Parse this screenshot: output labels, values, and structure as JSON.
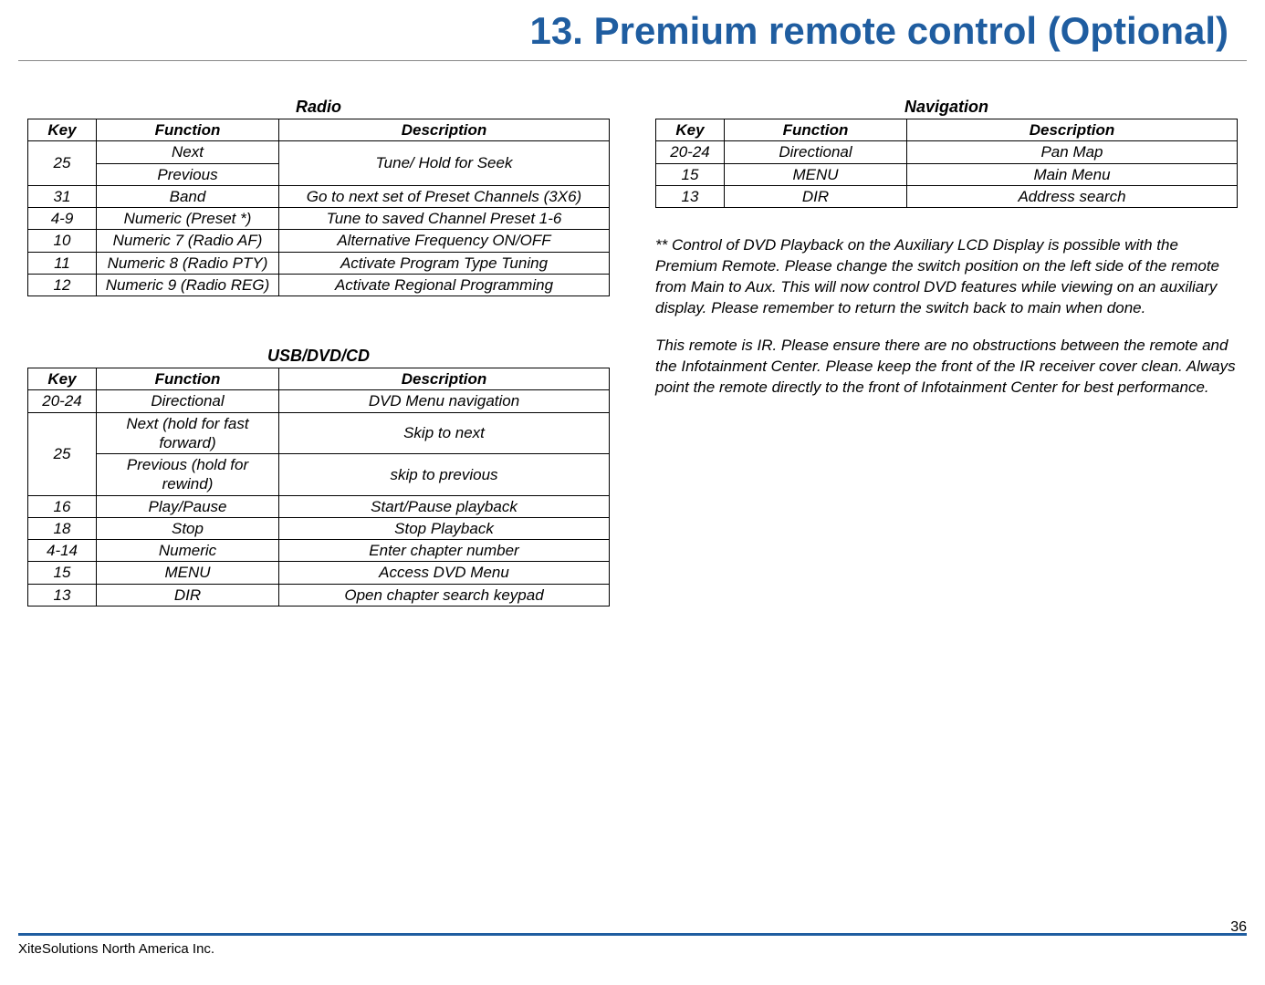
{
  "title": "13. Premium remote control (Optional)",
  "tables": {
    "radio": {
      "title": "Radio",
      "headers": {
        "key": "Key",
        "func": "Function",
        "desc": "Description"
      },
      "r1k": "25",
      "r1f": "Next",
      "r1d": "Tune/ Hold for Seek",
      "r2f": "Previous",
      "r3k": "31",
      "r3f": "Band",
      "r3d": "Go to next set of Preset Channels (3X6)",
      "r4k": "4-9",
      "r4f": "Numeric (Preset *)",
      "r4d": "Tune to saved Channel Preset 1-6",
      "r5k": "10",
      "r5f": "Numeric 7 (Radio AF)",
      "r5d": "Alternative Frequency ON/OFF",
      "r6k": "11",
      "r6f": "Numeric 8 (Radio PTY)",
      "r6d": "Activate Program Type Tuning",
      "r7k": "12",
      "r7f": "Numeric 9 (Radio REG)",
      "r7d": "Activate Regional Programming"
    },
    "usb": {
      "title": "USB/DVD/CD",
      "headers": {
        "key": "Key",
        "func": "Function",
        "desc": "Description"
      },
      "r1k": "20-24",
      "r1f": "Directional",
      "r1d": "DVD Menu navigation",
      "r2k": "25",
      "r2f": "Next (hold for fast forward)",
      "r2d": "Skip to next",
      "r3f": "Previous (hold for rewind)",
      "r3d": "skip to previous",
      "r4k": "16",
      "r4f": "Play/Pause",
      "r4d": "Start/Pause playback",
      "r5k": "18",
      "r5f": "Stop",
      "r5d": "Stop Playback",
      "r6k": "4-14",
      "r6f": "Numeric",
      "r6d": "Enter chapter number",
      "r7k": "15",
      "r7f": "MENU",
      "r7d": "Access DVD Menu",
      "r8k": "13",
      "r8f": "DIR",
      "r8d": "Open chapter search keypad"
    },
    "nav": {
      "title": "Navigation",
      "headers": {
        "key": "Key",
        "func": "Function",
        "desc": "Description"
      },
      "r1k": "20-24",
      "r1f": "Directional",
      "r1d": "Pan Map",
      "r2k": "15",
      "r2f": "MENU",
      "r2d": "Main Menu",
      "r3k": "13",
      "r3f": "DIR",
      "r3d": "Address search"
    }
  },
  "notes": {
    "p1": "** Control of DVD Playback on the Auxiliary LCD Display is possible with the Premium Remote. Please change the switch position on the left side of the remote from Main to Aux. This will now control DVD features while viewing on an auxiliary display. Please remember to return the switch back to main when done.",
    "p2": "This remote is IR. Please ensure there are no obstructions between the remote and the Infotainment Center. Please keep the front of the IR receiver cover clean. Always point the remote directly to the front of Infotainment Center for best performance."
  },
  "footer": {
    "company": "XiteSolutions North America Inc.",
    "page": "36"
  }
}
